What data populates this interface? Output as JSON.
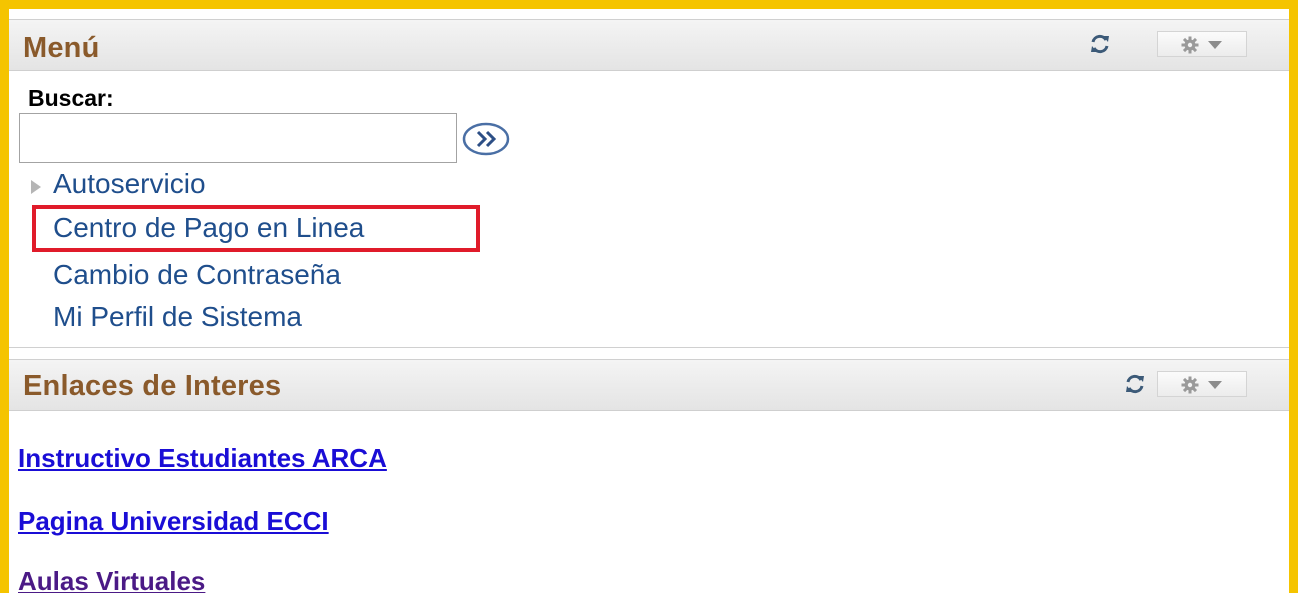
{
  "colors": {
    "frame_border": "#f5c400",
    "header_title": "#8a5a2b",
    "menu_link": "#1f4e8c",
    "link_unvisited": "#1a0dd6",
    "link_visited": "#4b1a86",
    "highlight": "#e01b2a"
  },
  "menu": {
    "title": "Menú",
    "refresh_icon": "refresh-icon",
    "options_icon": "gear-icon",
    "search": {
      "label": "Buscar:",
      "value": "",
      "placeholder": "",
      "go_icon": "double-chevron-right-icon"
    },
    "items": [
      {
        "label": "Autoservicio",
        "expandable": true
      },
      {
        "label": "Centro de Pago en Linea",
        "highlighted": true
      },
      {
        "label": "Cambio de Contraseña"
      },
      {
        "label": "Mi Perfil de Sistema"
      }
    ]
  },
  "enlaces": {
    "title": "Enlaces de Interes",
    "links": [
      {
        "label": "Instructivo Estudiantes ARCA",
        "visited": false
      },
      {
        "label": "Pagina Universidad ECCI",
        "visited": false
      },
      {
        "label": "Aulas Virtuales",
        "visited": true
      }
    ]
  }
}
